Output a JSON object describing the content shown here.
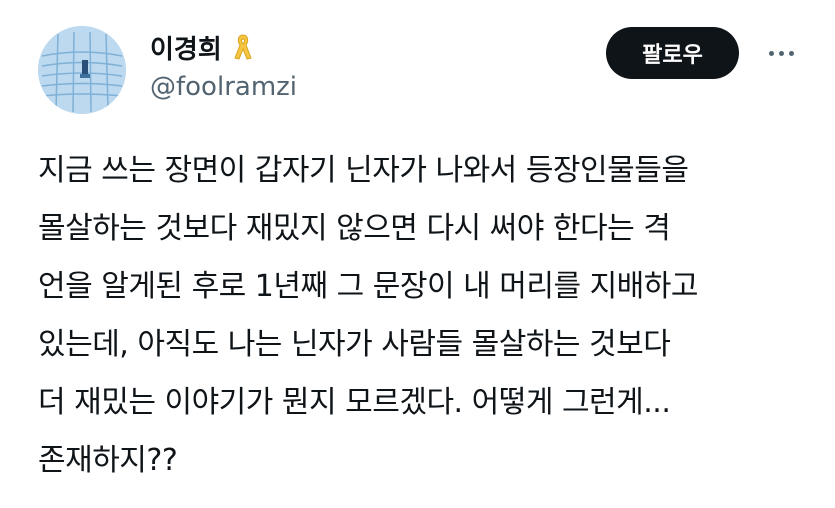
{
  "author": {
    "display_name": "이경희",
    "handle": "@foolramzi",
    "avatar_icon": "avatar-image",
    "badge_icon": "yellow-ribbon-icon",
    "badge_color": "#f5c542"
  },
  "actions": {
    "follow_label": "팔로우",
    "more_icon": "more-options-icon"
  },
  "tweet": {
    "lines": [
      "지금 쓰는 장면이 갑자기 닌자가 나와서 등장인물들을",
      "몰살하는 것보다 재밌지 않으면 다시 써야 한다는 격",
      "언을 알게된 후로 1년째 그 문장이 내 머리를 지배하고",
      "있는데, 아직도 나는 닌자가 사람들 몰살하는 것보다",
      "더 재밌는 이야기가 뭔지 모르겠다. 어떻게 그런게...",
      "존재하지??"
    ]
  },
  "colors": {
    "text": "#0f1419",
    "secondary": "#536471",
    "button_bg": "#0f1419",
    "avatar_bg": "#c8e1f4"
  }
}
